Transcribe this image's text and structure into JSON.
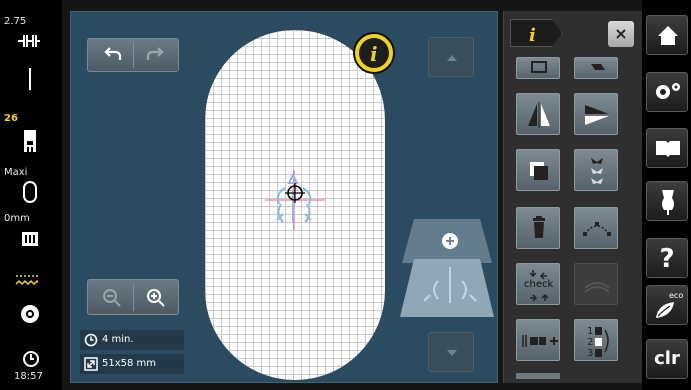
{
  "status": {
    "needle_value": "2.75",
    "thread_value": "26",
    "foot_label": "Maxi",
    "feed_label": "0mm",
    "time": "18:57"
  },
  "stitch_info": {
    "time_label": "4 min.",
    "size_label": "51x58 mm"
  },
  "panel": {
    "check_label": "check",
    "close_label": "×"
  },
  "sysbar": {
    "help_label": "?",
    "eco_label": "eco",
    "clr_label": "clr"
  },
  "colors": {
    "canvas_bg": "#2b4c60",
    "accent_yellow": "#f3d21c",
    "design_blue": "#8fb6e6",
    "design_pink": "#e05aa0"
  }
}
